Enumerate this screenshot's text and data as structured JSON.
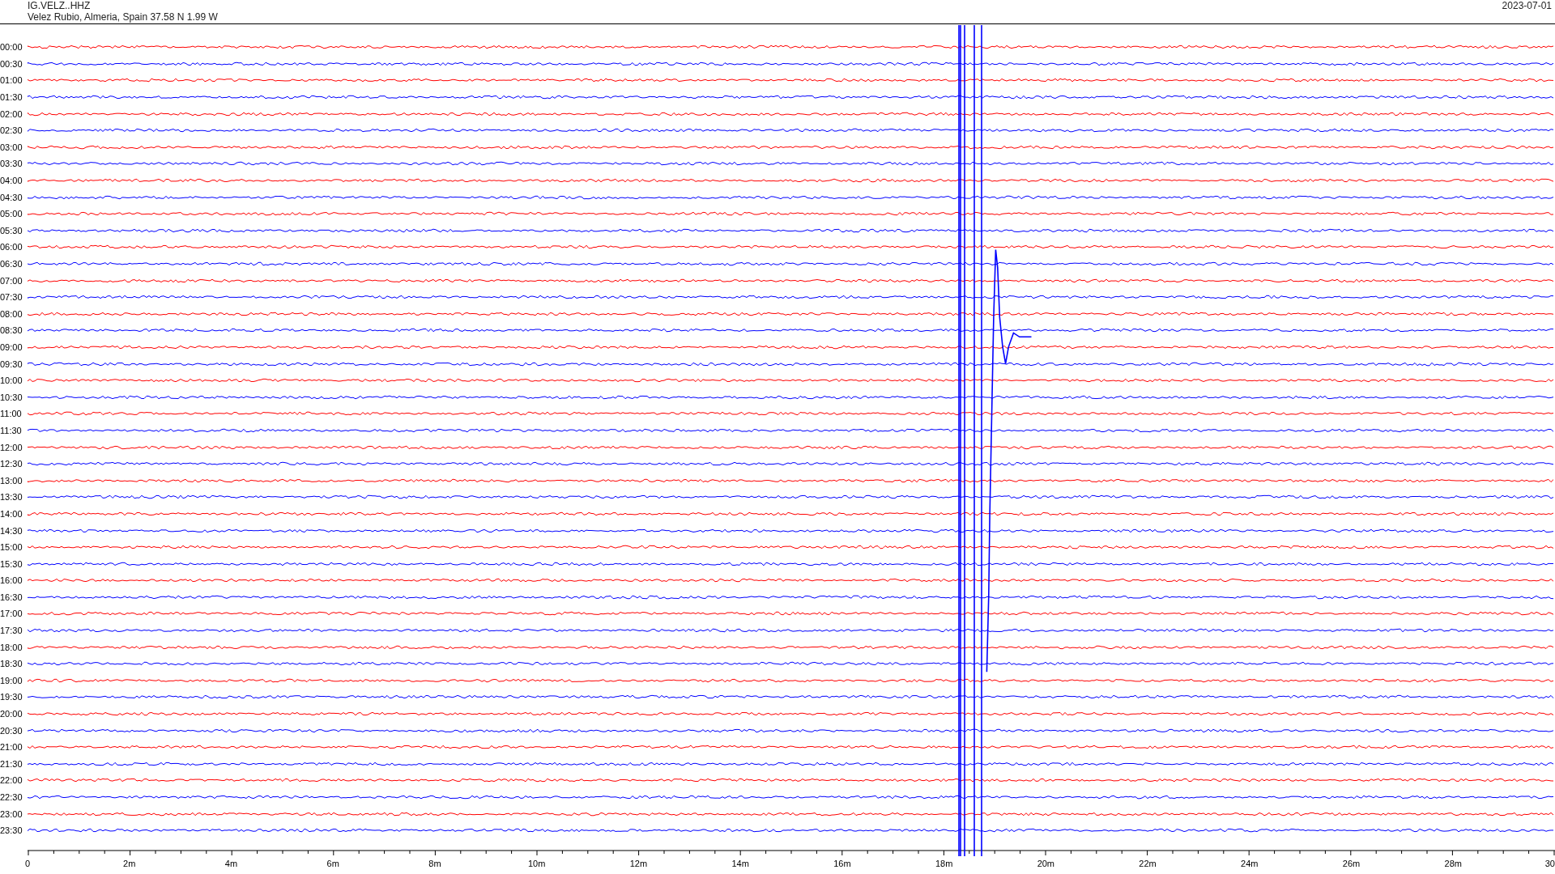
{
  "header": {
    "station": "IG.VELZ..HHZ",
    "location": "Velez Rubio, Almeria, Spain  37.58 N 1.99 W",
    "date": "2023-07-01"
  },
  "rows": [
    {
      "label": "00:00",
      "color": "#ff0000"
    },
    {
      "label": "00:30",
      "color": "#0000ff"
    },
    {
      "label": "01:00",
      "color": "#ff0000"
    },
    {
      "label": "01:30",
      "color": "#0000ff"
    },
    {
      "label": "02:00",
      "color": "#ff0000"
    },
    {
      "label": "02:30",
      "color": "#0000ff"
    },
    {
      "label": "03:00",
      "color": "#ff0000"
    },
    {
      "label": "03:30",
      "color": "#0000ff"
    },
    {
      "label": "04:00",
      "color": "#ff0000"
    },
    {
      "label": "04:30",
      "color": "#0000ff"
    },
    {
      "label": "05:00",
      "color": "#ff0000"
    },
    {
      "label": "05:30",
      "color": "#0000ff"
    },
    {
      "label": "06:00",
      "color": "#ff0000"
    },
    {
      "label": "06:30",
      "color": "#0000ff"
    },
    {
      "label": "07:00",
      "color": "#ff0000"
    },
    {
      "label": "07:30",
      "color": "#0000ff"
    },
    {
      "label": "08:00",
      "color": "#ff0000"
    },
    {
      "label": "08:30",
      "color": "#0000ff"
    },
    {
      "label": "09:00",
      "color": "#ff0000"
    },
    {
      "label": "09:30",
      "color": "#0000ff"
    },
    {
      "label": "10:00",
      "color": "#ff0000"
    },
    {
      "label": "10:30",
      "color": "#0000ff"
    },
    {
      "label": "11:00",
      "color": "#ff0000"
    },
    {
      "label": "11:30",
      "color": "#0000ff"
    },
    {
      "label": "12:00",
      "color": "#ff0000"
    },
    {
      "label": "12:30",
      "color": "#0000ff"
    },
    {
      "label": "13:00",
      "color": "#ff0000"
    },
    {
      "label": "13:30",
      "color": "#0000ff"
    },
    {
      "label": "14:00",
      "color": "#ff0000"
    },
    {
      "label": "14:30",
      "color": "#0000ff"
    },
    {
      "label": "15:00",
      "color": "#ff0000"
    },
    {
      "label": "15:30",
      "color": "#0000ff"
    },
    {
      "label": "16:00",
      "color": "#ff0000"
    },
    {
      "label": "16:30",
      "color": "#0000ff"
    },
    {
      "label": "17:00",
      "color": "#ff0000"
    },
    {
      "label": "17:30",
      "color": "#0000ff"
    },
    {
      "label": "18:00",
      "color": "#ff0000"
    },
    {
      "label": "18:30",
      "color": "#0000ff"
    },
    {
      "label": "19:00",
      "color": "#ff0000"
    },
    {
      "label": "19:30",
      "color": "#0000ff"
    },
    {
      "label": "20:00",
      "color": "#ff0000"
    },
    {
      "label": "20:30",
      "color": "#0000ff"
    },
    {
      "label": "21:00",
      "color": "#ff0000"
    },
    {
      "label": "21:30",
      "color": "#0000ff"
    },
    {
      "label": "22:00",
      "color": "#ff0000"
    },
    {
      "label": "22:30",
      "color": "#0000ff"
    },
    {
      "label": "23:00",
      "color": "#ff0000"
    },
    {
      "label": "23:30",
      "color": "#0000ff"
    }
  ],
  "axis": {
    "ticks": [
      "0",
      "2m",
      "4m",
      "6m",
      "8m",
      "10m",
      "12m",
      "14m",
      "16m",
      "18m",
      "20m",
      "22m",
      "24m",
      "26m",
      "28m",
      "30"
    ]
  }
}
